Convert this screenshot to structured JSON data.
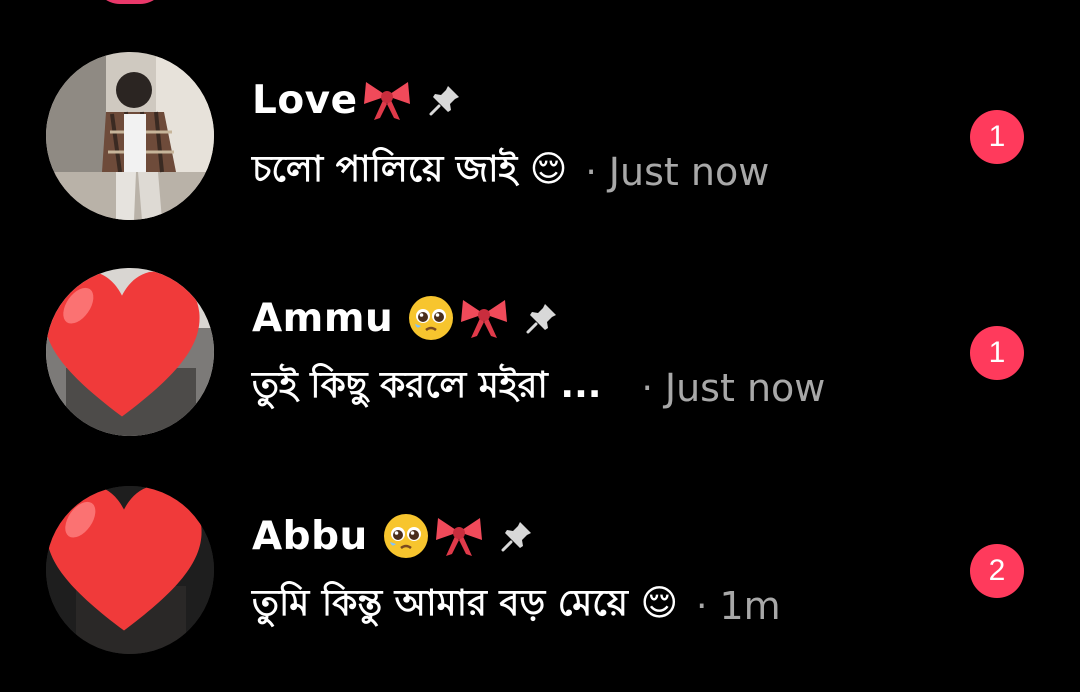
{
  "theme": {
    "background": "#000000",
    "badge_color": "#ff3a5c",
    "muted_text": "#a8a8a8",
    "heart_color": "#f03a3a"
  },
  "chats": [
    {
      "name": "Love",
      "name_emojis": [
        "ribbon-icon"
      ],
      "pinned": true,
      "message": "চলো পালিয়ে জাই 😌",
      "time": "Just now",
      "unread": "1",
      "avatar": "photo"
    },
    {
      "name": "Ammu",
      "name_emojis": [
        "pleading-face-icon",
        "ribbon-icon"
      ],
      "pinned": true,
      "message": "তুই কিছু করলে মইরা ...",
      "time": "Just now",
      "unread": "1",
      "avatar": "heart"
    },
    {
      "name": "Abbu",
      "name_emojis": [
        "pleading-face-icon",
        "ribbon-icon"
      ],
      "pinned": true,
      "message": "তুমি কিন্তু আমার বড় মেয়ে 😌",
      "time": "1m",
      "unread": "2",
      "avatar": "heart"
    }
  ],
  "separator": "·"
}
